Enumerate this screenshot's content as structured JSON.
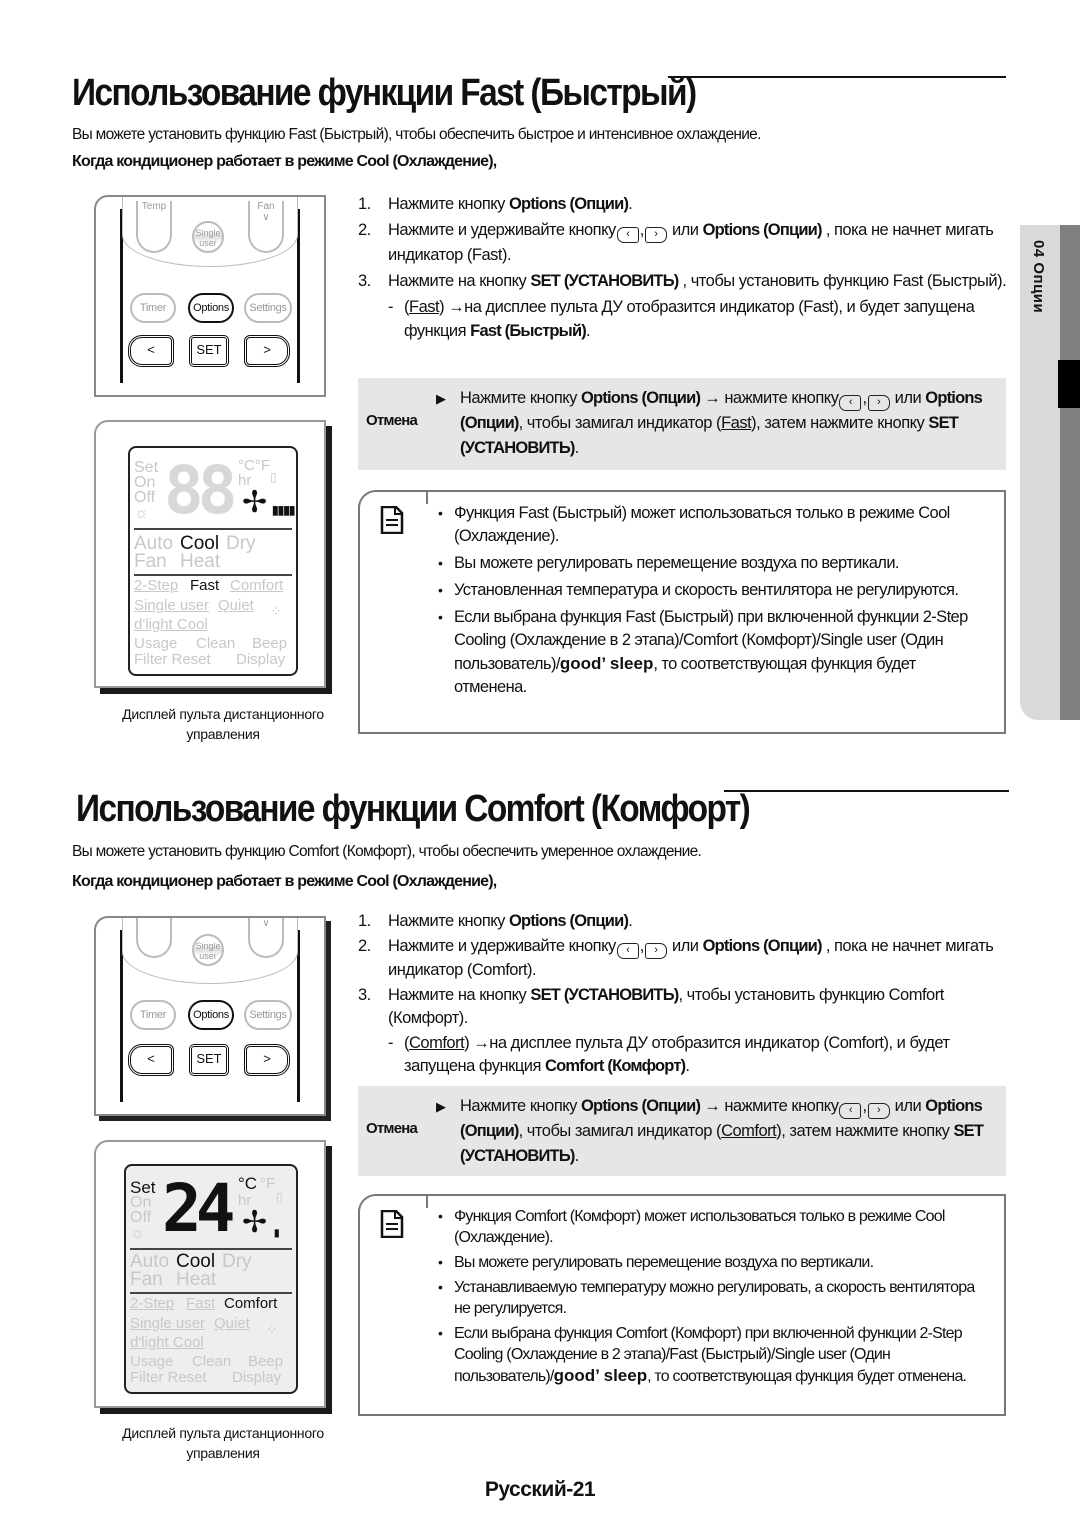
{
  "side_tab": {
    "label": "04 Опции"
  },
  "sections": [
    {
      "title": "Использование функции Fast (Быстрый)",
      "intro": "Вы можете установить функцию Fast (Быстрый), чтобы обеспечить быстрое и интенсивное охлаждение.",
      "subhead": "Когда кондиционер работает в режиме Cool (Охлаждение),",
      "remote": {
        "keys": {
          "temp": "Temp",
          "single": "Single user",
          "fan": "Fan",
          "timer": "Timer",
          "options": "Options",
          "settings": "Settings",
          "left": "<",
          "set": "SET",
          "right": ">"
        }
      },
      "lcd": {
        "digits": "88",
        "labels": {
          "set": "Set",
          "on": "On",
          "off": "Off",
          "units": "°C°F",
          "hr": "hr",
          "auto": "Auto",
          "cool": "Cool",
          "dry": "Dry",
          "fan": "Fan",
          "heat": "Heat",
          "two_step": "2-Step",
          "fast": "Fast",
          "comfort": "Comfort",
          "single_user": "Single user",
          "quiet": "Quiet",
          "dlight": "d'light Cool",
          "usage": "Usage",
          "clean": "Clean",
          "beep": "Beep",
          "filter_reset": "Filter Reset",
          "display": "Display"
        },
        "active": [
          "Cool",
          "Fast"
        ],
        "caption_line1": "Дисплей пульта дистанционного",
        "caption_line2": "управления"
      },
      "steps": [
        {
          "num": "1.",
          "pre": "Нажмите кнопку ",
          "bold": "Options (Опции)",
          "post": "."
        },
        {
          "num": "2.",
          "pre": "Нажмите и удерживайте кнопку",
          "mid": " или ",
          "bold": "Options (Опции)",
          "post": " , пока не начнет мигать индикатор (Fast)."
        },
        {
          "num": "3.",
          "pre": "Нажмите на кнопку ",
          "bold": "SET (УСТАНОВИТЬ)",
          "post": " , чтобы установить функцию Fast (Быстрый)."
        }
      ],
      "sub_step": {
        "dash": "-",
        "indicator": "Fast",
        "text": " →на дисплее пульта ДУ отобразится индикатор (Fast), и будет запущена функция ",
        "bold": "Fast (Быстрый)",
        "end": "."
      },
      "cancel": {
        "label": "Отмена",
        "pre": "Нажмите кнопку ",
        "bold1": "Options (Опции)",
        "mid1": " → нажмите кнопку",
        "mid2": " или ",
        "bold2": "Options (Опции)",
        "mid3": ", чтобы замигал индикатор (",
        "indicator": "Fast",
        "mid4": "), затем нажмите кнопку ",
        "bold3": "SET (УСТАНОВИТЬ)",
        "end": "."
      },
      "notes": [
        {
          "text": "Функция Fast (Быстрый) может использоваться только в режиме Cool (Охлаждение)."
        },
        {
          "text": "Вы можете регулировать перемещение воздуха по вертикали."
        },
        {
          "text": "Установленная температура и скорость вентилятора не регулируются."
        },
        {
          "pre": "Если выбрана функция Fast (Быстрый) при включенной функции 2-Step Cooling (Охлаждение в 2 этапа)/Comfort (Комфорт)/Single user (Один пользователь)/",
          "brand": "good’ sleep",
          "post": ", то соответствующая функция будет отменена."
        }
      ]
    },
    {
      "title": "Использование функции Comfort (Комфорт)",
      "intro": "Вы можете установить функцию Comfort (Комфорт), чтобы обеспечить умеренное охлаждение.",
      "subhead": "Когда кондиционер работает в режиме Cool (Охлаждение),",
      "remote": {
        "keys": {
          "single": "Single user",
          "timer": "Timer",
          "options": "Options",
          "settings": "Settings",
          "left": "<",
          "set": "SET",
          "right": ">"
        }
      },
      "lcd": {
        "digits": "24",
        "labels": {
          "set": "Set",
          "on": "On",
          "off": "Off",
          "celsius": "°C",
          "fahrenheit": "°F",
          "hr": "hr",
          "auto": "Auto",
          "cool": "Cool",
          "dry": "Dry",
          "fan": "Fan",
          "heat": "Heat",
          "two_step": "2-Step",
          "fast": "Fast",
          "comfort": "Comfort",
          "single_user": "Single user",
          "quiet": "Quiet",
          "dlight": "d'light Cool",
          "usage": "Usage",
          "clean": "Clean",
          "beep": "Beep",
          "filter_reset": "Filter Reset",
          "display": "Display"
        },
        "active": [
          "Set",
          "24",
          "°C",
          "Cool",
          "Comfort"
        ],
        "caption_line1": "Дисплей пульта дистанционного",
        "caption_line2": "управления"
      },
      "steps": [
        {
          "num": "1.",
          "pre": "Нажмите кнопку ",
          "bold": "Options (Опции)",
          "post": "."
        },
        {
          "num": "2.",
          "pre": "Нажмите и удерживайте кнопку",
          "mid": " или ",
          "bold": "Options (Опции)",
          "post": " , пока не начнет мигать индикатор (Comfort)."
        },
        {
          "num": "3.",
          "pre": "Нажмите на кнопку ",
          "bold": "SET (УСТАНОВИТЬ)",
          "post": ", чтобы установить функцию Comfort (Комфорт)."
        }
      ],
      "sub_step": {
        "dash": "-",
        "indicator": "Comfort",
        "text": " →на дисплее пульта ДУ отобразится индикатор (Comfort), и будет запущена функция ",
        "bold": "Comfort (Комфорт)",
        "end": "."
      },
      "cancel": {
        "label": "Отмена",
        "pre": "Нажмите кнопку ",
        "bold1": "Options (Опции)",
        "mid1": " → нажмите кнопку",
        "mid2": " или ",
        "bold2": "Options (Опции)",
        "mid3": ", чтобы замигал индикатор (",
        "indicator": "Comfort",
        "mid4": "), затем нажмите кнопку ",
        "bold3": "SET (УСТАНОВИТЬ)",
        "end": "."
      },
      "notes": [
        {
          "text": "Функция Comfort (Комфорт) может использоваться только в режиме Cool (Охлаждение)."
        },
        {
          "text": "Вы можете регулировать перемещение воздуха по вертикали."
        },
        {
          "text": "Устанавливаемую температуру можно регулировать, а скорость вентилятора не регулируется."
        },
        {
          "pre": "Если выбрана функция Comfort (Комфорт) при включенной функции 2-Step Cooling (Охлаждение в 2 этапа)/Fast (Быстрый)/Single user (Один пользователь)/",
          "brand": "good’ sleep",
          "post": ", то соответствующая функция будет отменена."
        }
      ]
    }
  ],
  "footer": {
    "page": "Русский-21"
  }
}
